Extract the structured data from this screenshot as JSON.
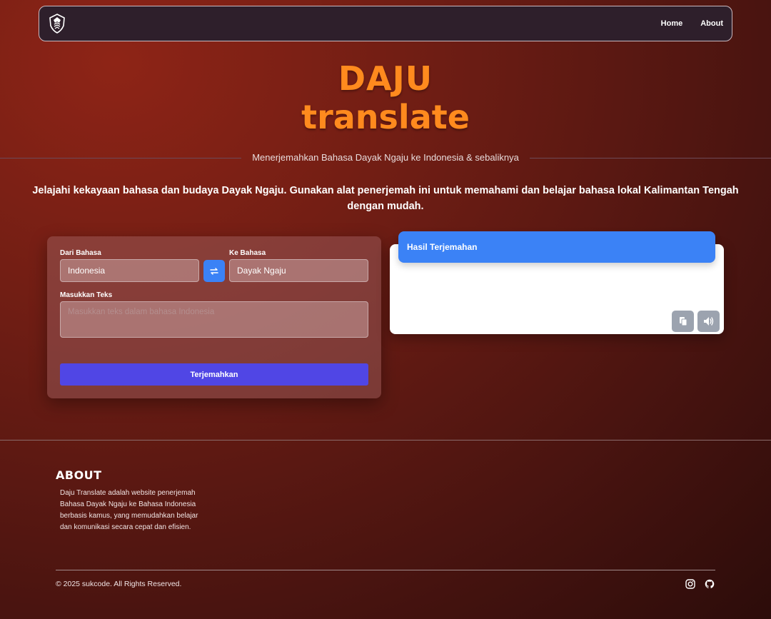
{
  "nav": {
    "logo_alt": "dayak-shield-logo",
    "links": [
      "Home",
      "About"
    ]
  },
  "hero": {
    "brand_line1": "DAJU",
    "brand_line2": "translate",
    "tagline": "Menerjemahkan Bahasa Dayak Ngaju ke Indonesia & sebaliknya",
    "intro": "Jelajahi kekayaan bahasa dan budaya Dayak Ngaju. Gunakan alat penerjemah ini untuk memahami dan belajar bahasa lokal Kalimantan Tengah dengan mudah."
  },
  "translator": {
    "from_label": "Dari Bahasa",
    "from_value": "Indonesia",
    "to_label": "Ke Bahasa",
    "to_value": "Dayak Ngaju",
    "input_label": "Masukkan Teks",
    "input_placeholder": "Masukkan teks dalam bahasa Indonesia",
    "translate_button": "Terjemahkan"
  },
  "result": {
    "header": "Hasil Terjemahan"
  },
  "footer": {
    "about_title": "ABOUT",
    "about_text": "Daju Translate adalah website penerjemah Bahasa Dayak Ngaju ke Bahasa Indonesia berbasis kamus, yang memudahkan belajar dan komunikasi secara cepat dan efisien.",
    "copyright": "© 2025 sukcode. All Rights Reserved."
  },
  "colors": {
    "brand": "#ff8a1e",
    "primary_blue": "#3b82f6",
    "button_indigo": "#5046e5",
    "icon_gray": "#9ca3af"
  }
}
